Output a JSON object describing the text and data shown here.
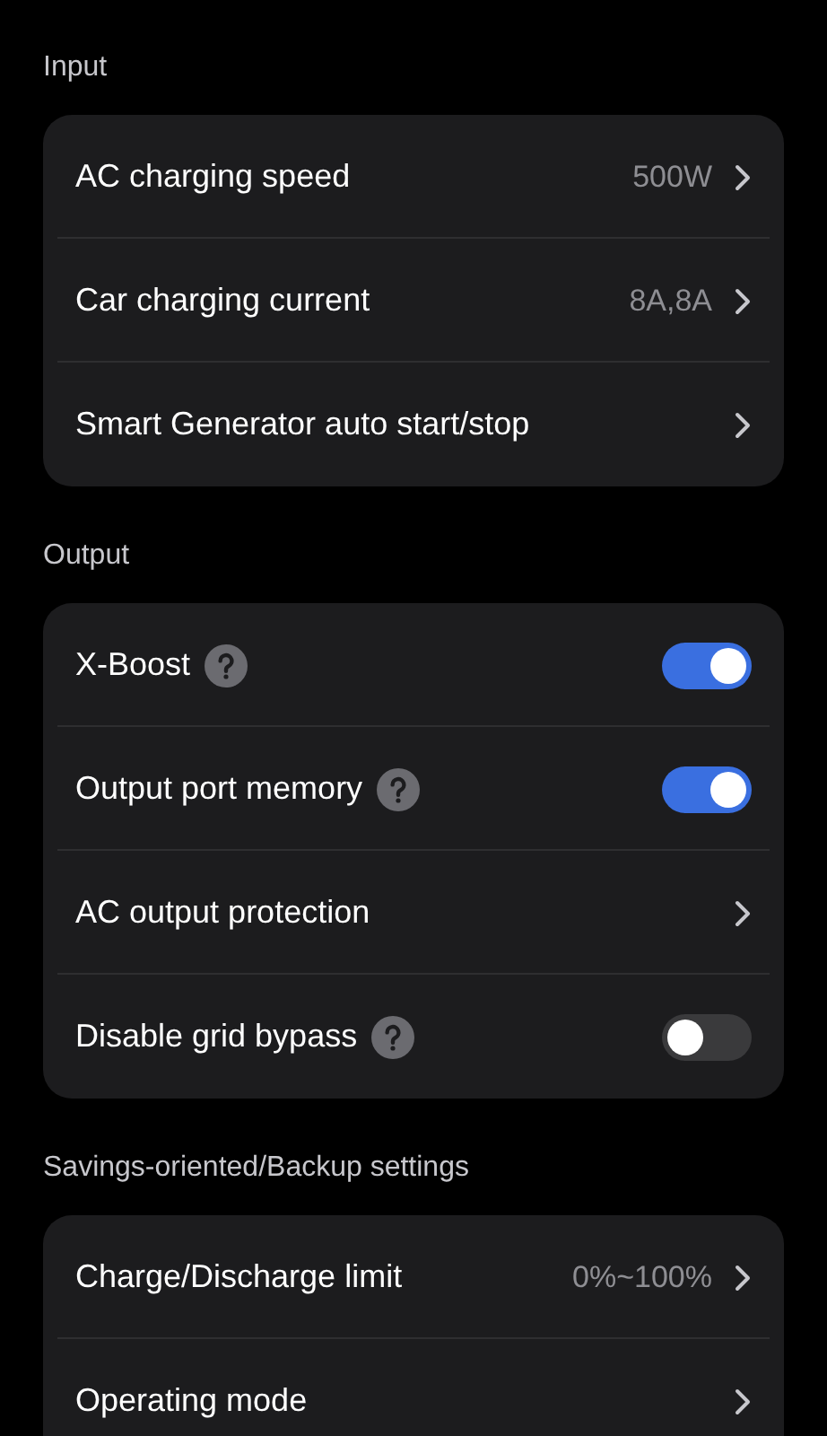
{
  "sections": [
    {
      "title": "Input",
      "rows": [
        {
          "kind": "value",
          "label": "AC charging speed",
          "value": "500W"
        },
        {
          "kind": "value",
          "label": "Car charging current",
          "value": "8A,8A"
        },
        {
          "kind": "link",
          "label": "Smart Generator auto start/stop"
        }
      ]
    },
    {
      "title": "Output",
      "rows": [
        {
          "kind": "toggle",
          "label": "X-Boost",
          "help": true,
          "on": true
        },
        {
          "kind": "toggle",
          "label": "Output port memory",
          "help": true,
          "on": true
        },
        {
          "kind": "link",
          "label": "AC output protection"
        },
        {
          "kind": "toggle",
          "label": "Disable grid bypass",
          "help": true,
          "on": false
        }
      ]
    },
    {
      "title": "Savings-oriented/Backup settings",
      "rows": [
        {
          "kind": "value",
          "label": "Charge/Discharge limit",
          "value": "0%~100%"
        },
        {
          "kind": "link",
          "label": "Operating mode"
        }
      ]
    }
  ]
}
